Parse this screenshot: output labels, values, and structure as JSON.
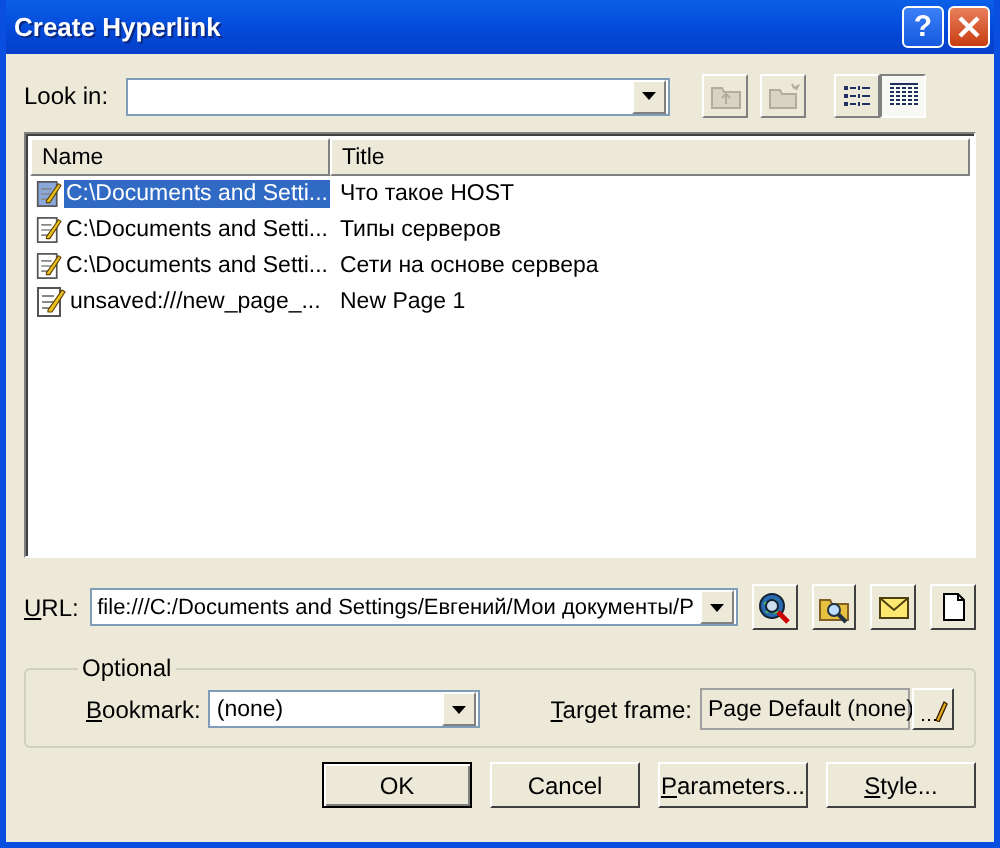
{
  "window": {
    "title": "Create Hyperlink",
    "help": "?"
  },
  "look_in": {
    "label": "Look in:"
  },
  "toolbar": [
    {
      "kind": "up-folder",
      "disabled": true
    },
    {
      "kind": "new-folder",
      "disabled": true
    },
    {
      "kind": "list-view",
      "selected": false
    },
    {
      "kind": "details-view",
      "selected": true
    }
  ],
  "file_list": {
    "columns": [
      "Name",
      "Title"
    ],
    "rows": [
      {
        "name": "C:\\Documents and Setti...",
        "title": "Что такое HOST",
        "selected": true
      },
      {
        "name": "C:\\Documents and Setti...",
        "title": "Типы серверов",
        "selected": false
      },
      {
        "name": "C:\\Documents and Setti...",
        "title": "Сети на основе сервера",
        "selected": false
      },
      {
        "name": "unsaved:///new_page_...",
        "title": "New Page 1",
        "selected": false
      }
    ]
  },
  "url": {
    "label": "URL:",
    "access_key": true,
    "value": "file:///C:/Documents and Settings/Евгений/Мои документы/P"
  },
  "url_buttons": [
    {
      "kind": "web"
    },
    {
      "kind": "file"
    },
    {
      "kind": "email"
    },
    {
      "kind": "new-page"
    }
  ],
  "optional": {
    "legend": "Optional",
    "bookmark": {
      "label": "Bookmark:",
      "access_key": true,
      "value": "(none)"
    },
    "target_frame": {
      "label": "Target frame:",
      "access_key": true,
      "value": "Page Default (none)"
    }
  },
  "buttons": [
    {
      "label": "OK",
      "default": true,
      "access_key": false
    },
    {
      "label": "Cancel",
      "default": false,
      "access_key": false
    },
    {
      "label": "Parameters...",
      "default": false,
      "access_key": true
    },
    {
      "label": "Style...",
      "default": false,
      "access_key": true
    }
  ]
}
